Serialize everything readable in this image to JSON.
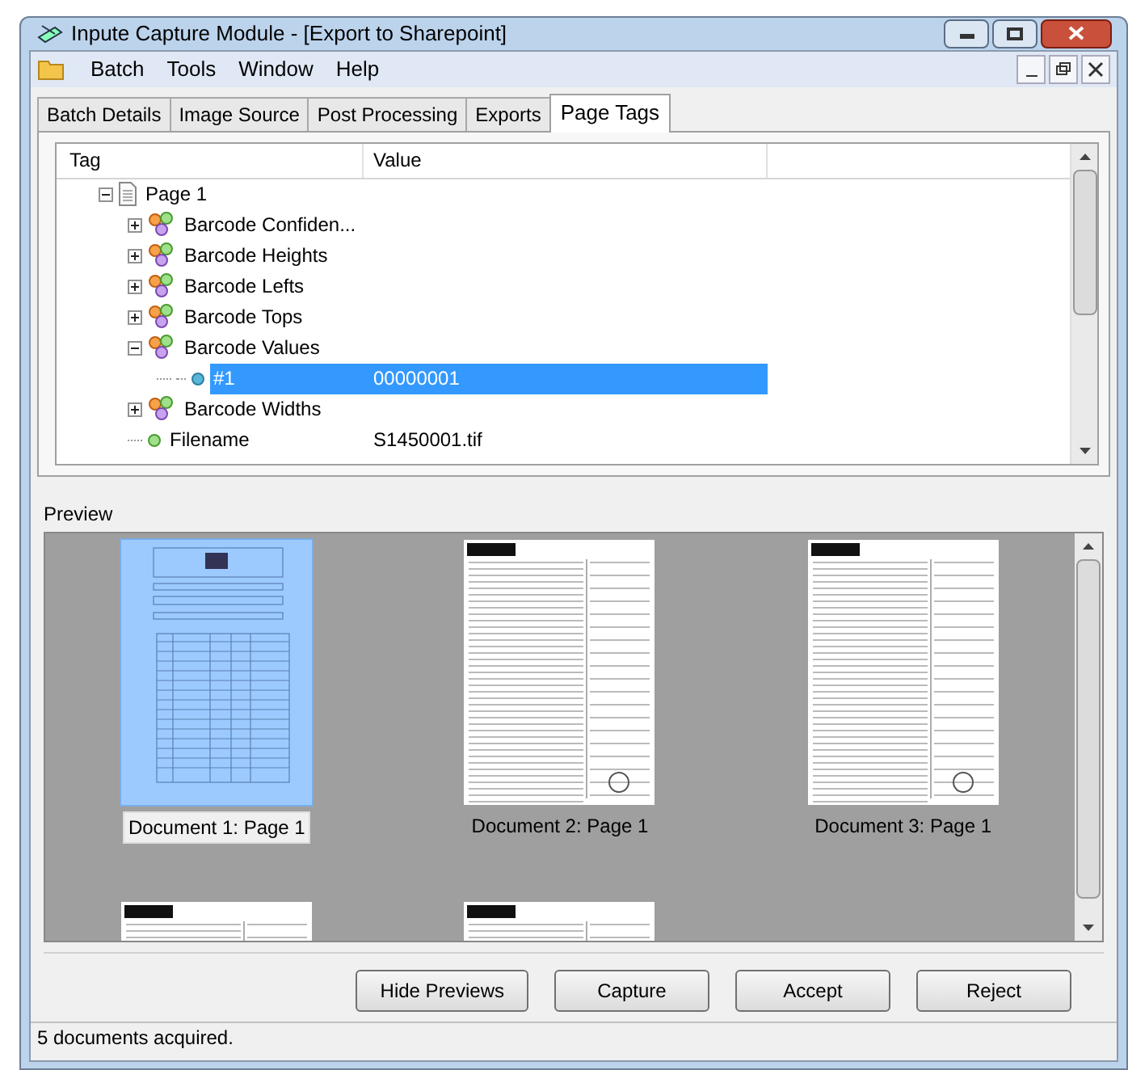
{
  "window": {
    "title": "Inpute Capture Module - [Export to Sharepoint]"
  },
  "menu": [
    "Batch",
    "Tools",
    "Window",
    "Help"
  ],
  "tabs": [
    {
      "label": "Batch Details",
      "selected": false
    },
    {
      "label": "Image Source",
      "selected": false
    },
    {
      "label": "Post Processing",
      "selected": false
    },
    {
      "label": "Exports",
      "selected": false
    },
    {
      "label": "Page Tags",
      "selected": true
    }
  ],
  "tag_table": {
    "columns": [
      "Tag",
      "Value"
    ],
    "tree": [
      {
        "kind": "page",
        "tag": "Page 1",
        "expanded": true,
        "selected": false,
        "children": [
          {
            "kind": "group",
            "tag": "Barcode Confiden...",
            "expanded": false,
            "selected": false
          },
          {
            "kind": "group",
            "tag": "Barcode Heights",
            "expanded": false,
            "selected": false
          },
          {
            "kind": "group",
            "tag": "Barcode Lefts",
            "expanded": false,
            "selected": false
          },
          {
            "kind": "group",
            "tag": "Barcode Tops",
            "expanded": false,
            "selected": false
          },
          {
            "kind": "group",
            "tag": "Barcode Values",
            "expanded": true,
            "selected": false,
            "children": [
              {
                "kind": "value",
                "tag": "#1",
                "value": "00000001",
                "selected": true
              }
            ]
          },
          {
            "kind": "group",
            "tag": "Barcode Widths",
            "expanded": false,
            "selected": false
          },
          {
            "kind": "field",
            "tag": "Filename",
            "value": "S1450001.tif",
            "selected": false
          }
        ]
      }
    ]
  },
  "preview": {
    "label": "Preview",
    "documents": [
      {
        "label": "Document 1: Page 1",
        "selected": true,
        "kind": "table-form"
      },
      {
        "label": "Document 2: Page 1",
        "selected": false,
        "kind": "survey-form"
      },
      {
        "label": "Document 3: Page 1",
        "selected": false,
        "kind": "survey-form"
      },
      {
        "selected": false,
        "kind": "survey-form"
      },
      {
        "selected": false,
        "kind": "survey-form"
      }
    ]
  },
  "buttons": [
    {
      "label": "Hide Previews"
    },
    {
      "label": "Capture"
    },
    {
      "label": "Accept"
    },
    {
      "label": "Reject"
    }
  ],
  "status_bar": "5 documents acquired."
}
